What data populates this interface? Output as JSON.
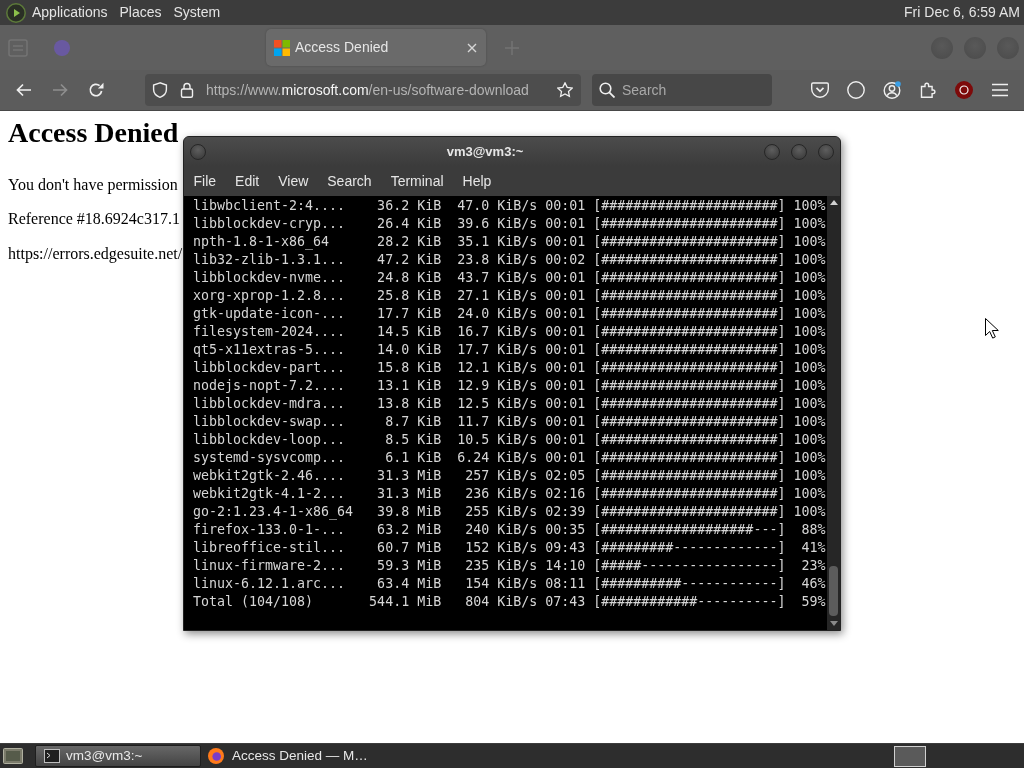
{
  "top_panel": {
    "menus": [
      "Applications",
      "Places",
      "System"
    ],
    "clock": "Fri Dec 6, 6:59 AM"
  },
  "browser": {
    "tabs": [
      {
        "selected": false
      },
      {
        "title": "Access Denied",
        "selected": true
      }
    ],
    "nav_buttons": [
      {
        "kind": "back",
        "disabled": false
      },
      {
        "kind": "forward",
        "disabled": true
      },
      {
        "kind": "reload",
        "disabled": false
      }
    ],
    "address": {
      "prefix": "https://www.",
      "host": "microsoft.com",
      "path": "/en-us/software-download"
    },
    "search": {
      "placeholder": "Search"
    },
    "page": {
      "heading": "Access Denied",
      "paragraphs": [
        "You don't have permission",
        "Reference #18.6924c317.1",
        "https://errors.edgesuite.net/"
      ]
    }
  },
  "terminal": {
    "title": "vm3@vm3:~",
    "menu": [
      "File",
      "Edit",
      "View",
      "Search",
      "Terminal",
      "Help"
    ],
    "lines": [
      "libwbclient-2:4....    36.2 KiB  47.0 KiB/s 00:01 [######################] 100%",
      "libblockdev-cryp...    26.4 KiB  39.6 KiB/s 00:01 [######################] 100%",
      "npth-1.8-1-x86_64      28.2 KiB  35.1 KiB/s 00:01 [######################] 100%",
      "lib32-zlib-1.3.1...    47.2 KiB  23.8 KiB/s 00:02 [######################] 100%",
      "libblockdev-nvme...    24.8 KiB  43.7 KiB/s 00:01 [######################] 100%",
      "xorg-xprop-1.2.8...    25.8 KiB  27.1 KiB/s 00:01 [######################] 100%",
      "gtk-update-icon-...    17.7 KiB  24.0 KiB/s 00:01 [######################] 100%",
      "filesystem-2024....    14.5 KiB  16.7 KiB/s 00:01 [######################] 100%",
      "qt5-x11extras-5....    14.0 KiB  17.7 KiB/s 00:01 [######################] 100%",
      "libblockdev-part...    15.8 KiB  12.1 KiB/s 00:01 [######################] 100%",
      "nodejs-nopt-7.2....    13.1 KiB  12.9 KiB/s 00:01 [######################] 100%",
      "libblockdev-mdra...    13.8 KiB  12.5 KiB/s 00:01 [######################] 100%",
      "libblockdev-swap...     8.7 KiB  11.7 KiB/s 00:01 [######################] 100%",
      "libblockdev-loop...     8.5 KiB  10.5 KiB/s 00:01 [######################] 100%",
      "systemd-sysvcomp...     6.1 KiB  6.24 KiB/s 00:01 [######################] 100%",
      "webkit2gtk-2.46....    31.3 MiB   257 KiB/s 02:05 [######################] 100%",
      "webkit2gtk-4.1-2...    31.3 MiB   236 KiB/s 02:16 [######################] 100%",
      "go-2:1.23.4-1-x86_64   39.8 MiB   255 KiB/s 02:39 [######################] 100%",
      "firefox-133.0-1-...    63.2 MiB   240 KiB/s 00:35 [###################---]  88%",
      "libreoffice-stil...    60.7 MiB   152 KiB/s 09:43 [#########-------------]  41%",
      "linux-firmware-2...    59.3 MiB   235 KiB/s 14:10 [#####-----------------]  23%",
      "linux-6.12.1.arc...    63.4 MiB   154 KiB/s 08:11 [##########------------]  46%",
      "Total (104/108)       544.1 MiB   804 KiB/s 07:43 [############----------]  59%"
    ]
  },
  "taskbar": {
    "tasks": [
      {
        "kind": "terminal",
        "label": "vm3@vm3:~",
        "selected": true
      },
      {
        "kind": "browser",
        "label": "Access Denied — M…",
        "selected": false
      }
    ]
  }
}
